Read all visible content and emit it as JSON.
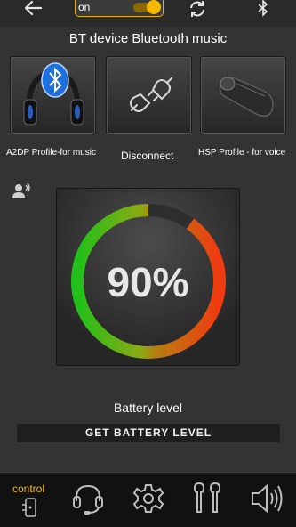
{
  "topbar": {
    "toggle_label": "on",
    "icons": [
      "back-arrow-icon",
      "refresh-icon",
      "bluetooth-icon"
    ]
  },
  "title": "BT device Bluetooth music",
  "profiles": [
    {
      "label": "A2DP Profile-for music",
      "icon": "bluetooth-headphones-icon"
    },
    {
      "label": "Disconnect",
      "icon": "unplug-icon"
    },
    {
      "label": "HSP Profile - for voice",
      "icon": "earpiece-headset-icon"
    }
  ],
  "battery": {
    "percent_text": "90%",
    "level": 0.9,
    "label": "Battery level",
    "button_label": "GET BATTERY LEVEL"
  },
  "bottom_nav": {
    "control_label": "control",
    "items": [
      "control-icon",
      "headset-icon",
      "settings-icon",
      "earbuds-icon",
      "speaker-icon"
    ]
  },
  "colors": {
    "accent": "#f6b900",
    "background": "#333333",
    "gauge_green": "#22c01a",
    "gauge_red": "#f03a10"
  }
}
